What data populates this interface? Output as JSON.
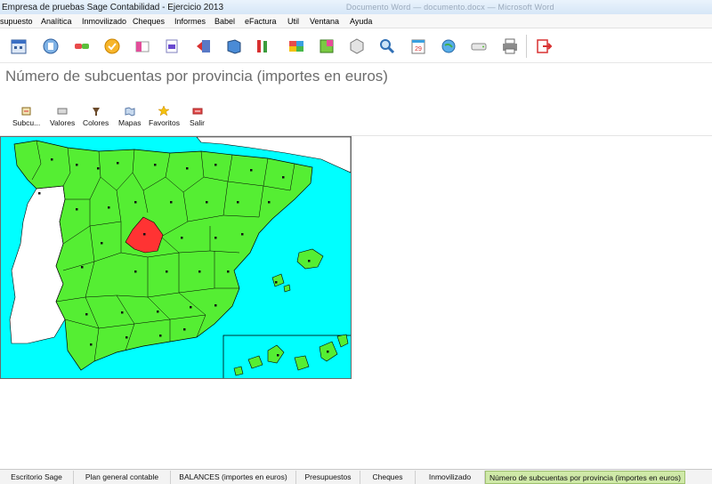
{
  "window": {
    "title": "Empresa de pruebas Sage Contabilidad - Ejercicio 2013",
    "ghost_text": "Documento Word — documento.docx — Microsoft Word"
  },
  "menu": [
    "supuesto",
    "Analítica",
    "Inmovilizado",
    "Cheques",
    "Informes",
    "Babel",
    "eFactura",
    "Util",
    "Ventana",
    "Ayuda"
  ],
  "toolbar": {
    "icons": [
      "calendar-icon",
      "bank-icon",
      "link-icon",
      "check-icon",
      "invoice-icon",
      "document-pdf-icon",
      "arrow-left-icon",
      "book-icon",
      "tools-icon",
      "stack-icon",
      "grid-icon",
      "cube-icon",
      "search-icon",
      "calendar-day-icon",
      "globe-icon",
      "drive-icon",
      "printer-icon",
      "exit-icon"
    ],
    "calendar_day": "29"
  },
  "page": {
    "title": "Número de subcuentas por provincia (importes en euros)"
  },
  "subtoolbar": [
    {
      "label": "Subcu...",
      "icon": "subaccount-icon"
    },
    {
      "label": "Valores",
      "icon": "values-icon"
    },
    {
      "label": "Colores",
      "icon": "colors-icon"
    },
    {
      "label": "Mapas",
      "icon": "maps-icon"
    },
    {
      "label": "Favoritos",
      "icon": "star-icon"
    },
    {
      "label": "Salir",
      "icon": "exit-icon"
    }
  ],
  "map": {
    "sea_color": "#00ffff",
    "land_color": "#55ee33",
    "highlight_color": "#ff3333",
    "highlighted_province": "Madrid"
  },
  "tabs": [
    {
      "label": "Escritorio Sage",
      "active": false
    },
    {
      "label": "Plan general contable",
      "active": false
    },
    {
      "label": "BALANCES (importes en euros)",
      "active": false
    },
    {
      "label": "Presupuestos",
      "active": false
    },
    {
      "label": "Cheques",
      "active": false
    },
    {
      "label": "Inmovilizado",
      "active": false
    },
    {
      "label": "Número de subcuentas por provincia (importes en euros)",
      "active": true
    }
  ]
}
